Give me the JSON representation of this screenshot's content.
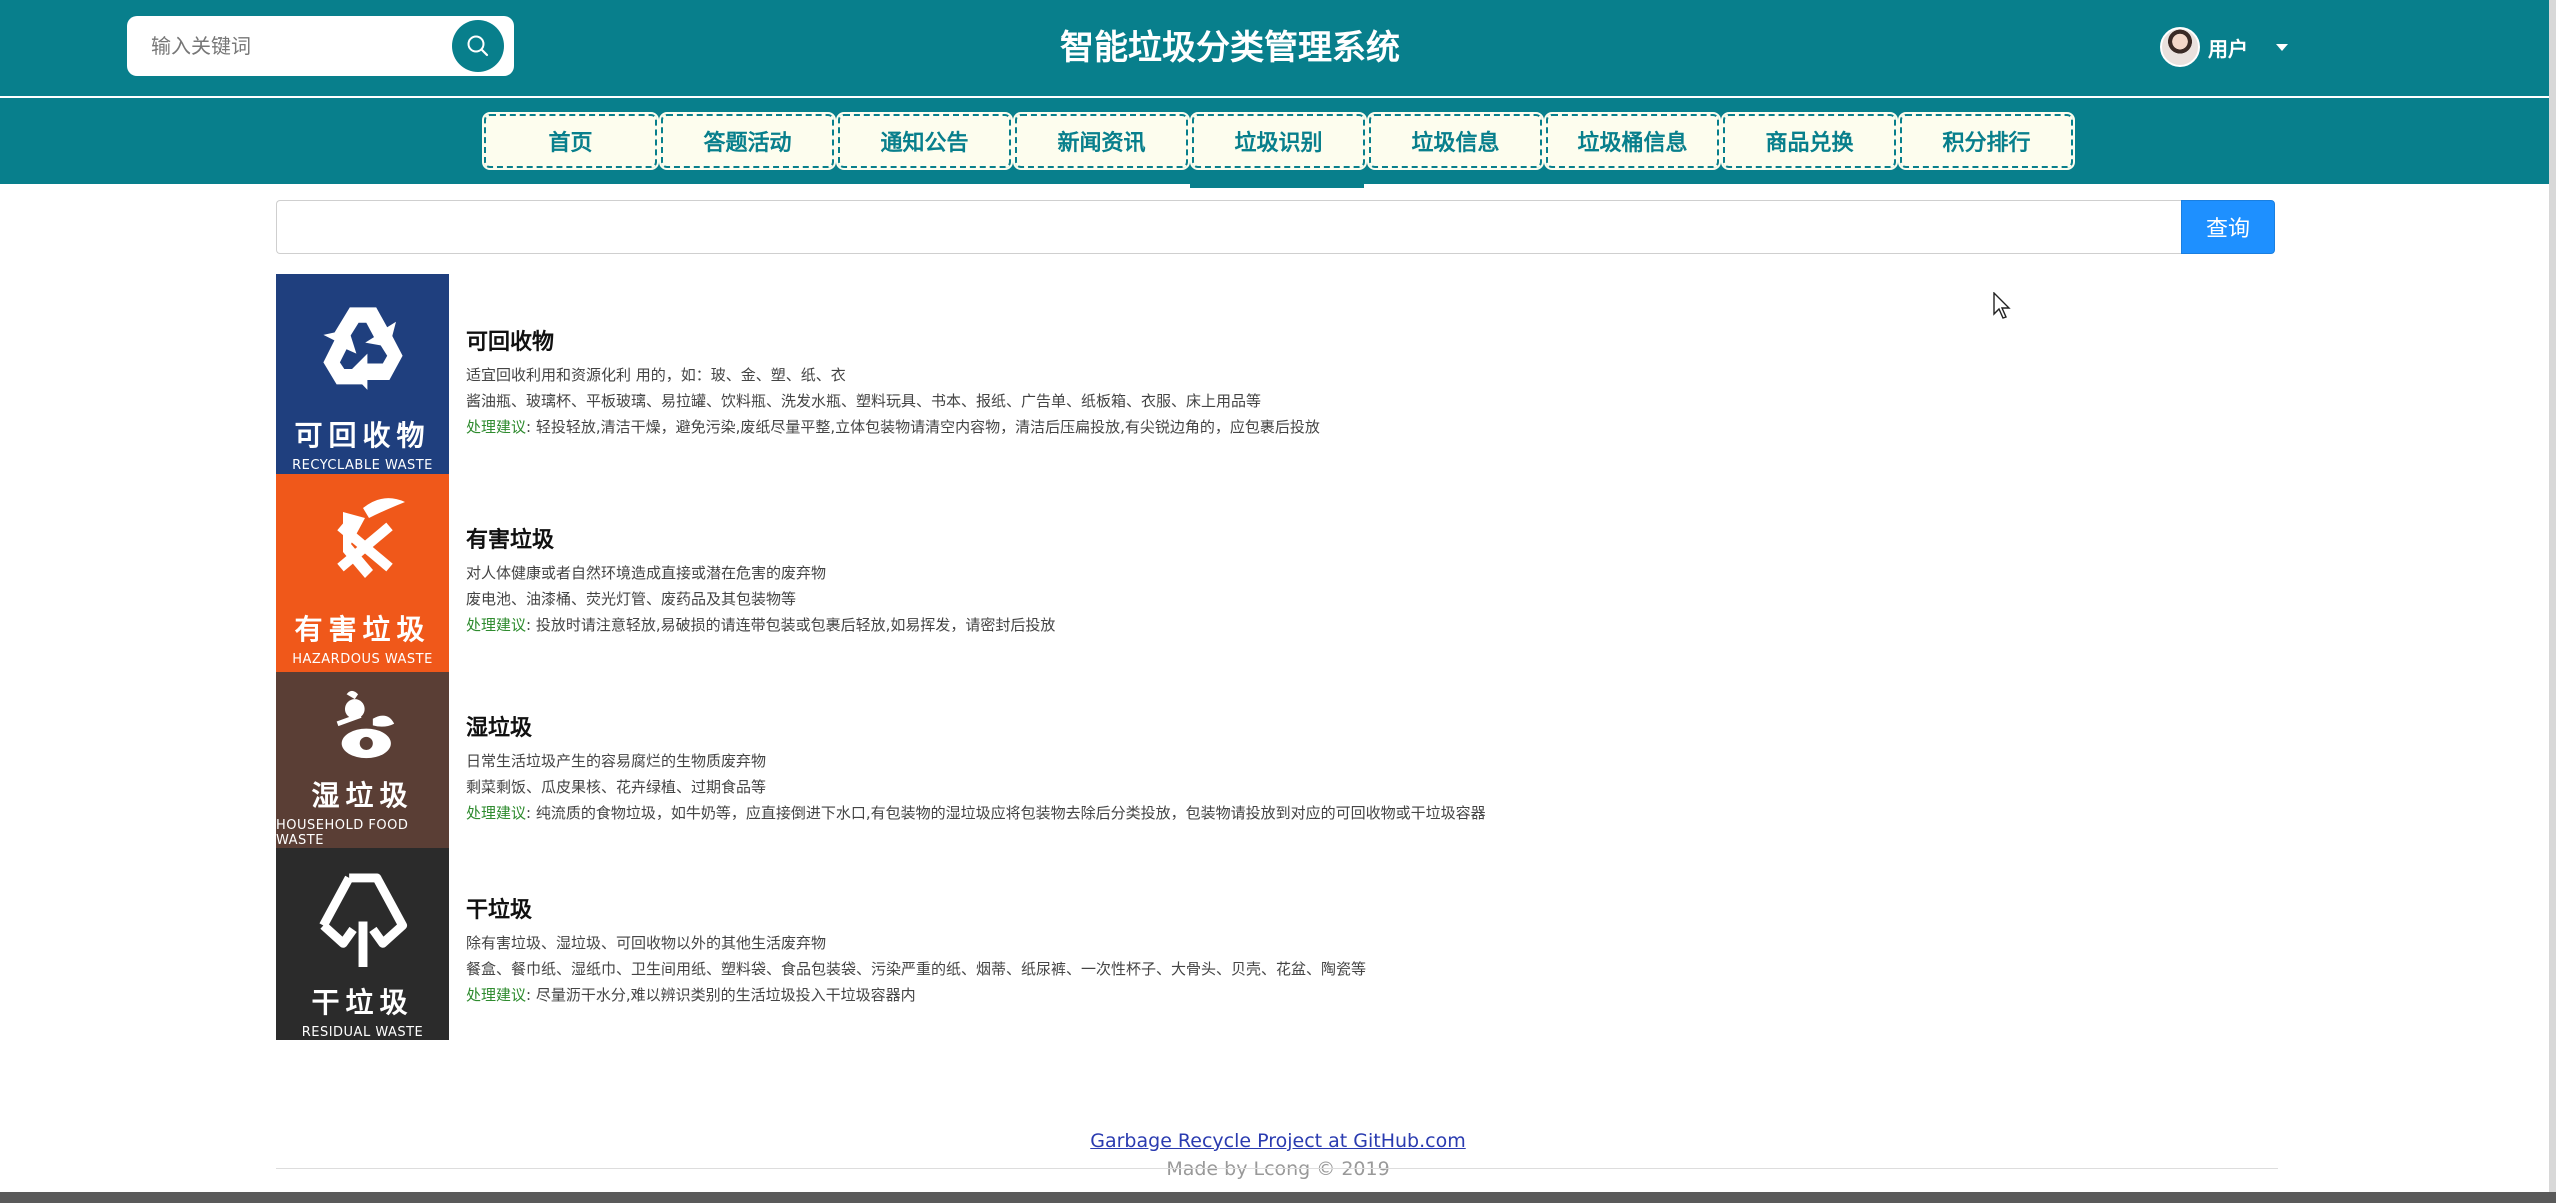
{
  "header": {
    "search_placeholder": "输入关键词",
    "title": "智能垃圾分类管理系统",
    "user_name": "用户"
  },
  "nav": {
    "items": [
      "首页",
      "答题活动",
      "通知公告",
      "新闻资讯",
      "垃圾识别",
      "垃圾信息",
      "垃圾桶信息",
      "商品兑换",
      "积分排行"
    ],
    "active": "垃圾识别"
  },
  "query": {
    "value": "",
    "button_label": "查询"
  },
  "categories": [
    {
      "icon_cn": "可回收物",
      "icon_en": "RECYCLABLE WASTE",
      "color": "#1f3f7e",
      "title": "可回收物",
      "description": "适宜回收利用和资源化利 用的，如：玻、金、塑、纸、衣",
      "examples": "酱油瓶、玻璃杯、平板玻璃、易拉罐、饮料瓶、洗发水瓶、塑料玩具、书本、报纸、广告单、纸板箱、衣服、床上用品等",
      "advice_label": "处理建议",
      "advice": ": 轻投轻放,清洁干燥，避免污染,废纸尽量平整,立体包装物请清空内容物，清洁后压扁投放,有尖锐边角的，应包裹后投放"
    },
    {
      "icon_cn": "有害垃圾",
      "icon_en": "HAZARDOUS WASTE",
      "color": "#f0581a",
      "title": "有害垃圾",
      "description": "对人体健康或者自然环境造成直接或潜在危害的废弃物",
      "examples": "废电池、油漆桶、荧光灯管、废药品及其包装物等",
      "advice_label": "处理建议",
      "advice": ": 投放时请注意轻放,易破损的请连带包装或包裹后轻放,如易挥发，请密封后投放"
    },
    {
      "icon_cn": "湿垃圾",
      "icon_en": "HOUSEHOLD FOOD WASTE",
      "color": "#5a3e35",
      "title": "湿垃圾",
      "description": "日常生活垃圾产生的容易腐烂的生物质废弃物",
      "examples": "剩菜剩饭、瓜皮果核、花卉绿植、过期食品等",
      "advice_label": "处理建议",
      "advice": ": 纯流质的食物垃圾，如牛奶等，应直接倒进下水口,有包装物的湿垃圾应将包装物去除后分类投放，包装物请投放到对应的可回收物或干垃圾容器"
    },
    {
      "icon_cn": "干垃圾",
      "icon_en": "RESIDUAL WASTE",
      "color": "#2b2b2b",
      "title": "干垃圾",
      "description": "除有害垃圾、湿垃圾、可回收物以外的其他生活废弃物",
      "examples": "餐盒、餐巾纸、湿纸巾、卫生间用纸、塑料袋、食品包装袋、污染严重的纸、烟蒂、纸尿裤、一次性杯子、大骨头、贝壳、花盆、陶瓷等",
      "advice_label": "处理建议",
      "advice": ": 尽量沥干水分,难以辨识类别的生活垃圾投入干垃圾容器内"
    }
  ],
  "footer": {
    "link": "Garbage Recycle Project at GitHub.com",
    "made_by": "Made by Lcong © 2019"
  },
  "theme": {
    "primary": "#087f8c",
    "nav_bg": "#fdfdee",
    "query_button": "#1e90ff",
    "advice_label": "#2e8b2e"
  }
}
